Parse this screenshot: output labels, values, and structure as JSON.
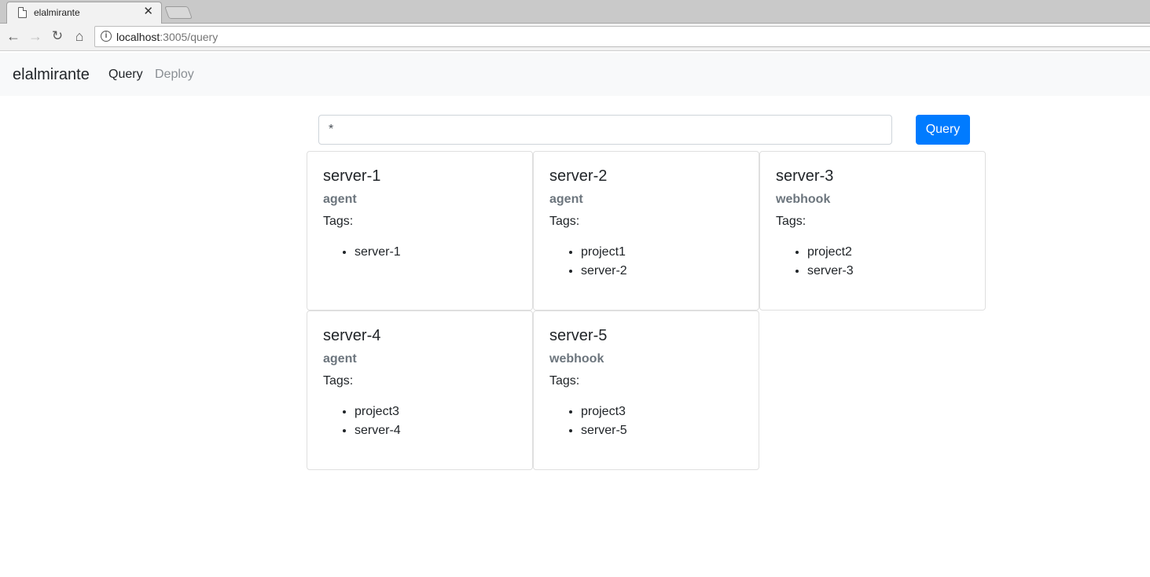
{
  "browser": {
    "tab_title": "elalmirante",
    "url_host": "localhost",
    "url_path": ":3005/query"
  },
  "navbar": {
    "brand": "elalmirante",
    "links": [
      "Query",
      "Deploy"
    ]
  },
  "query": {
    "input_value": "*",
    "button_label": "Query"
  },
  "tags_label": "Tags:",
  "servers": [
    {
      "name": "server-1",
      "type": "agent",
      "tags": [
        "server-1"
      ]
    },
    {
      "name": "server-2",
      "type": "agent",
      "tags": [
        "project1",
        "server-2"
      ]
    },
    {
      "name": "server-3",
      "type": "webhook",
      "tags": [
        "project2",
        "server-3"
      ]
    },
    {
      "name": "server-4",
      "type": "agent",
      "tags": [
        "project3",
        "server-4"
      ]
    },
    {
      "name": "server-5",
      "type": "webhook",
      "tags": [
        "project3",
        "server-5"
      ]
    }
  ],
  "colors": {
    "primary": "#007bff",
    "navbar_bg": "#f8f9fa",
    "muted": "#6c757d"
  }
}
